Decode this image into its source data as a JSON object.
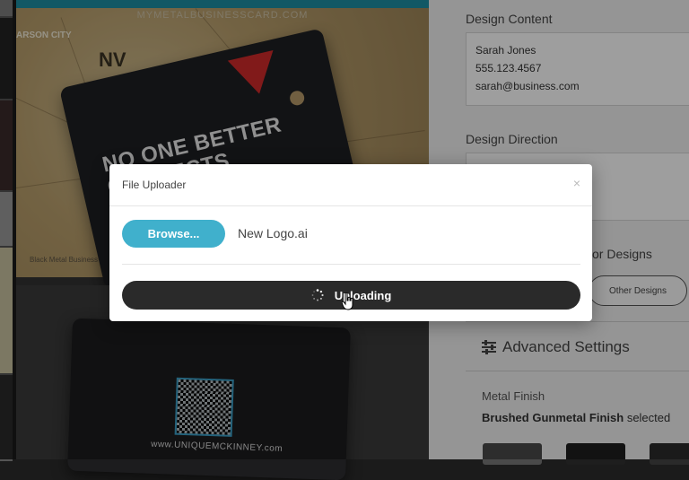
{
  "gallery": {
    "watermark": "MYMETALBUSINESSCARD.COM",
    "map_city_label": "ARSON CITY",
    "map_state_label": "NV",
    "map_caption": "Black Metal Business C...",
    "card1_text": "NO ONE BETTER CONNECTS",
    "card2_url": "www.UNIQUEMCKINNEY.com"
  },
  "panel": {
    "design_content_title": "Design Content",
    "design_content_lines": [
      "Sarah Jones",
      "555.123.4567",
      "sarah@business.com"
    ],
    "design_direction_title": "Design Direction",
    "other_designs_label_partial": "or Designs",
    "other_designs_button": "Other Designs",
    "advanced_settings_label": "Advanced Settings",
    "metal_finish_title": "Metal Finish",
    "metal_finish_value": "Brushed Gunmetal Finish",
    "metal_finish_suffix": "selected"
  },
  "modal": {
    "title": "File Uploader",
    "close_glyph": "×",
    "browse_label": "Browse...",
    "file_name": "New Logo.ai",
    "upload_label": "Uploading"
  },
  "colors": {
    "browse_button": "#40b0cc",
    "upload_button": "#2a2a2a",
    "accent_bar": "#1d8fa3"
  }
}
